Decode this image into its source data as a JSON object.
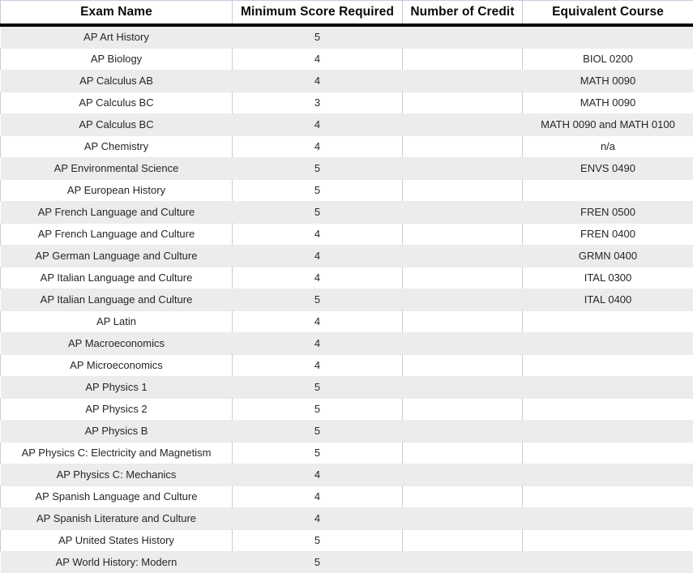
{
  "table": {
    "columns": [
      {
        "key": "exam_name",
        "label": "Exam Name",
        "align": "center"
      },
      {
        "key": "min_score",
        "label": "Minimum Score Required",
        "align": "center"
      },
      {
        "key": "num_credit",
        "label": "Number of Credit",
        "align": "center"
      },
      {
        "key": "equiv_course",
        "label": "Equivalent Course",
        "align": "center"
      }
    ],
    "colors": {
      "header_text": "#0a0a0a",
      "header_rule": "#000000",
      "gridline": "#c7ccdd",
      "row_white": "#ffffff",
      "row_gray": "#ececec",
      "body_text": "#262626"
    },
    "row_count": 25,
    "rows": [
      {
        "exam_name": "AP Art History",
        "min_score": "5",
        "num_credit": "",
        "equiv_course": ""
      },
      {
        "exam_name": "AP Biology",
        "min_score": "4",
        "num_credit": "",
        "equiv_course": "BIOL 0200"
      },
      {
        "exam_name": "AP Calculus AB",
        "min_score": "4",
        "num_credit": "",
        "equiv_course": "MATH 0090"
      },
      {
        "exam_name": "AP Calculus BC",
        "min_score": "3",
        "num_credit": "",
        "equiv_course": "MATH 0090"
      },
      {
        "exam_name": "AP Calculus BC",
        "min_score": "4",
        "num_credit": "",
        "equiv_course": "MATH 0090 and MATH 0100"
      },
      {
        "exam_name": "AP Chemistry",
        "min_score": "4",
        "num_credit": "",
        "equiv_course": "n/a"
      },
      {
        "exam_name": "AP Environmental Science",
        "min_score": "5",
        "num_credit": "",
        "equiv_course": "ENVS 0490"
      },
      {
        "exam_name": "AP European History",
        "min_score": "5",
        "num_credit": "",
        "equiv_course": ""
      },
      {
        "exam_name": "AP French Language and Culture",
        "min_score": "5",
        "num_credit": "",
        "equiv_course": "FREN 0500"
      },
      {
        "exam_name": "AP French Language and Culture",
        "min_score": "4",
        "num_credit": "",
        "equiv_course": "FREN 0400"
      },
      {
        "exam_name": "AP German Language and Culture",
        "min_score": "4",
        "num_credit": "",
        "equiv_course": "GRMN 0400"
      },
      {
        "exam_name": "AP Italian Language and Culture",
        "min_score": "4",
        "num_credit": "",
        "equiv_course": "ITAL 0300"
      },
      {
        "exam_name": "AP Italian Language and Culture",
        "min_score": "5",
        "num_credit": "",
        "equiv_course": "ITAL 0400"
      },
      {
        "exam_name": "AP Latin",
        "min_score": "4",
        "num_credit": "",
        "equiv_course": ""
      },
      {
        "exam_name": "AP Macroeconomics",
        "min_score": "4",
        "num_credit": "",
        "equiv_course": ""
      },
      {
        "exam_name": "AP Microeconomics",
        "min_score": "4",
        "num_credit": "",
        "equiv_course": ""
      },
      {
        "exam_name": "AP Physics 1",
        "min_score": "5",
        "num_credit": "",
        "equiv_course": ""
      },
      {
        "exam_name": "AP Physics 2",
        "min_score": "5",
        "num_credit": "",
        "equiv_course": ""
      },
      {
        "exam_name": "AP Physics B",
        "min_score": "5",
        "num_credit": "",
        "equiv_course": ""
      },
      {
        "exam_name": "AP Physics C: Electricity and Magnetism",
        "min_score": "5",
        "num_credit": "",
        "equiv_course": ""
      },
      {
        "exam_name": "AP Physics C: Mechanics",
        "min_score": "4",
        "num_credit": "",
        "equiv_course": ""
      },
      {
        "exam_name": "AP Spanish Language and Culture",
        "min_score": "4",
        "num_credit": "",
        "equiv_course": ""
      },
      {
        "exam_name": "AP Spanish Literature and Culture",
        "min_score": "4",
        "num_credit": "",
        "equiv_course": ""
      },
      {
        "exam_name": "AP United States History",
        "min_score": "5",
        "num_credit": "",
        "equiv_course": ""
      },
      {
        "exam_name": "AP World History: Modern",
        "min_score": "5",
        "num_credit": "",
        "equiv_course": ""
      }
    ]
  }
}
